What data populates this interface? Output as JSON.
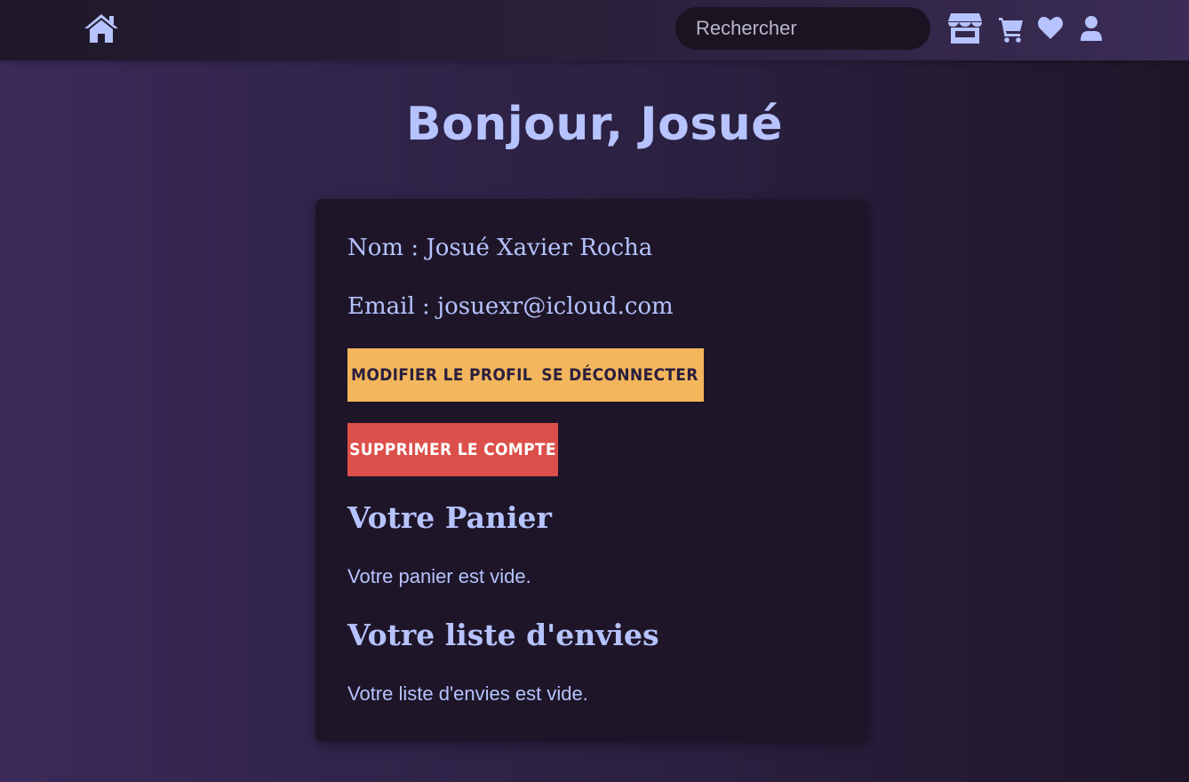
{
  "navbar": {
    "search_placeholder": "Rechercher",
    "icons": [
      "home-icon",
      "store-icon",
      "cart-icon",
      "heart-icon",
      "user-icon"
    ]
  },
  "greeting": "Bonjour, Josué",
  "profile": {
    "name_line": "Nom : Josué Xavier Rocha",
    "email_line": "Email : josuexr@icloud.com"
  },
  "actions": {
    "edit_profile": "MODIFIER LE PROFIL",
    "logout": "SE DÉCONNECTER",
    "delete_account": "SUPPRIMER LE COMPTE"
  },
  "cart": {
    "title": "Votre Panier",
    "empty_message": "Votre panier est vide."
  },
  "wishlist": {
    "title": "Votre liste d'envies",
    "empty_message": "Votre liste d'envies est vide."
  },
  "colors": {
    "accent": "#b6c3ff",
    "button_yellow": "#f3b65c",
    "button_red": "#dc4f4a",
    "card_bg": "#1e1628"
  }
}
